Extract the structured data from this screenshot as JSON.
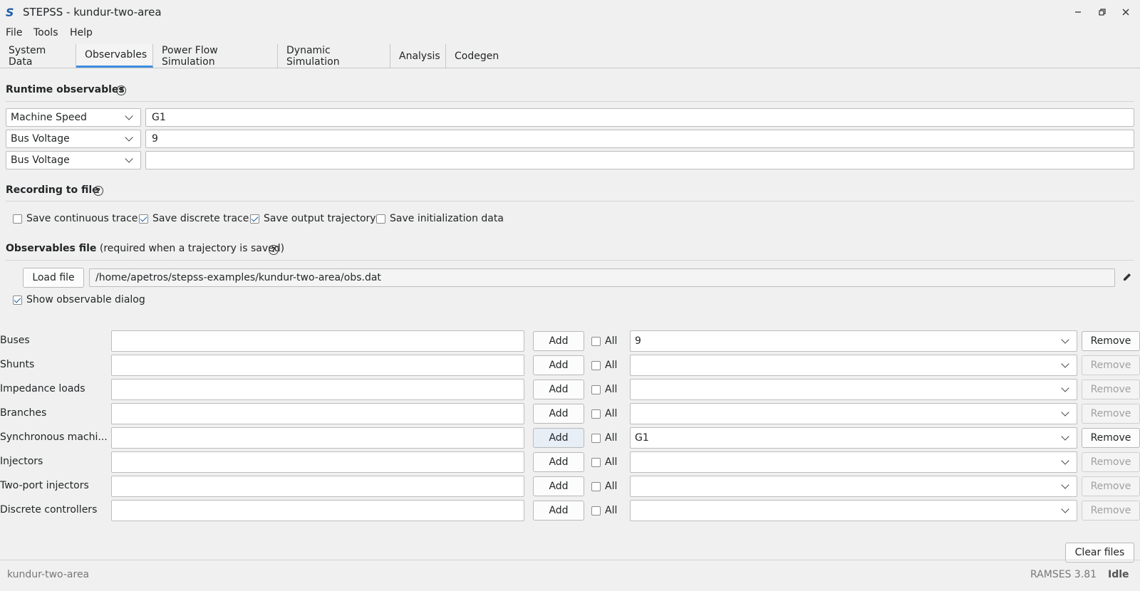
{
  "window": {
    "title": "STEPSS - kundur-two-area",
    "icon": "stepss-logo-icon",
    "controls": [
      "minimize-icon",
      "restore-icon",
      "close-icon"
    ]
  },
  "menu": [
    "File",
    "Tools",
    "Help"
  ],
  "tabs": [
    {
      "label": "System Data",
      "active": false
    },
    {
      "label": "Observables",
      "active": true
    },
    {
      "label": "Power Flow Simulation",
      "active": false
    },
    {
      "label": "Dynamic Simulation",
      "active": false
    },
    {
      "label": "Analysis",
      "active": false
    },
    {
      "label": "Codegen",
      "active": false
    }
  ],
  "runtime": {
    "title": "Runtime observables",
    "rows": [
      {
        "type": "Machine Speed",
        "value": "G1"
      },
      {
        "type": "Bus Voltage",
        "value": "9"
      },
      {
        "type": "Bus Voltage",
        "value": ""
      }
    ]
  },
  "recording": {
    "title": "Recording to file",
    "options": [
      {
        "label": "Save continuous trace",
        "checked": false
      },
      {
        "label": "Save discrete trace",
        "checked": true
      },
      {
        "label": "Save output trajectory",
        "checked": true
      },
      {
        "label": "Save initialization data",
        "checked": false
      }
    ]
  },
  "obsfile": {
    "title": "Observables file",
    "subtitle": "(required when a trajectory is saved)",
    "load_label": "Load file",
    "path": "/home/apetros/stepss-examples/kundur-two-area/obs.dat",
    "show_dialog_label": "Show observable dialog",
    "show_dialog_checked": true
  },
  "elements": {
    "add_label": "Add",
    "all_label": "All",
    "remove_label": "Remove",
    "rows": [
      {
        "label": "Buses",
        "input": "",
        "selected": "9",
        "remove_enabled": true
      },
      {
        "label": "Shunts",
        "input": "",
        "selected": "",
        "remove_enabled": false
      },
      {
        "label": "Impedance loads",
        "input": "",
        "selected": "",
        "remove_enabled": false
      },
      {
        "label": "Branches",
        "input": "",
        "selected": "",
        "remove_enabled": false
      },
      {
        "label": "Synchronous machi...",
        "input": "",
        "selected": "G1",
        "remove_enabled": true
      },
      {
        "label": "Injectors",
        "input": "",
        "selected": "",
        "remove_enabled": false
      },
      {
        "label": "Two-port injectors",
        "input": "",
        "selected": "",
        "remove_enabled": false
      },
      {
        "label": "Discrete controllers",
        "input": "",
        "selected": "",
        "remove_enabled": false
      }
    ]
  },
  "clear_files_label": "Clear files",
  "status": {
    "project": "kundur-two-area",
    "version": "RAMSES 3.81",
    "state": "Idle"
  }
}
